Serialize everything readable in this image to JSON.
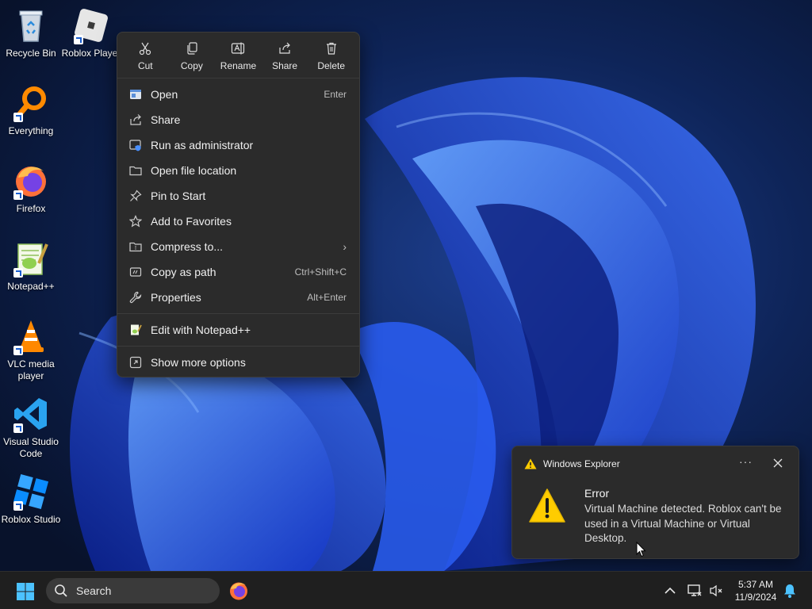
{
  "desktop": {
    "icons": [
      {
        "label": "Recycle Bin",
        "icon": "recycle-bin-icon"
      },
      {
        "label": "Roblox Player",
        "icon": "roblox-player-icon"
      },
      {
        "label": "Everything",
        "icon": "everything-search-icon"
      },
      {
        "label": "Firefox",
        "icon": "firefox-icon"
      },
      {
        "label": "Notepad++",
        "icon": "notepad-plus-plus-icon"
      },
      {
        "label": "VLC media player",
        "icon": "vlc-icon"
      },
      {
        "label": "Visual Studio Code",
        "icon": "vscode-icon"
      },
      {
        "label": "Roblox Studio",
        "icon": "roblox-studio-icon"
      }
    ]
  },
  "context_menu": {
    "quick_actions": [
      {
        "label": "Cut",
        "icon": "scissors-icon"
      },
      {
        "label": "Copy",
        "icon": "copy-icon"
      },
      {
        "label": "Rename",
        "icon": "rename-icon"
      },
      {
        "label": "Share",
        "icon": "share-icon"
      },
      {
        "label": "Delete",
        "icon": "trash-icon"
      }
    ],
    "items": [
      {
        "label": "Open",
        "shortcut": "Enter",
        "icon": "open-app-icon"
      },
      {
        "label": "Share",
        "shortcut": "",
        "icon": "share-icon"
      },
      {
        "label": "Run as administrator",
        "shortcut": "",
        "icon": "shield-icon"
      },
      {
        "label": "Open file location",
        "shortcut": "",
        "icon": "folder-icon"
      },
      {
        "label": "Pin to Start",
        "shortcut": "",
        "icon": "pin-icon"
      },
      {
        "label": "Add to Favorites",
        "shortcut": "",
        "icon": "star-icon"
      },
      {
        "label": "Compress to...",
        "shortcut": "",
        "icon": "zip-folder-icon",
        "submenu": true
      },
      {
        "label": "Copy as path",
        "shortcut": "Ctrl+Shift+C",
        "icon": "copy-path-icon"
      },
      {
        "label": "Properties",
        "shortcut": "Alt+Enter",
        "icon": "wrench-icon"
      },
      {
        "label": "Edit with Notepad++",
        "shortcut": "",
        "icon": "notepad-plus-plus-icon"
      },
      {
        "label": "Show more options",
        "shortcut": "",
        "icon": "more-options-icon"
      }
    ]
  },
  "toast": {
    "app_name": "Windows Explorer",
    "more_label": "···",
    "title": "Error",
    "body": "Virtual Machine detected. Roblox can't be used in a Virtual Machine or Virtual Desktop."
  },
  "taskbar": {
    "search_label": "Search",
    "time": "5:37 AM",
    "date": "11/9/2024"
  },
  "colors": {
    "menu_bg": "#2b2b2b",
    "taskbar_bg": "#1f1f1f",
    "warning_yellow": "#ffcc00",
    "accent_blue": "#1a5fd0"
  }
}
